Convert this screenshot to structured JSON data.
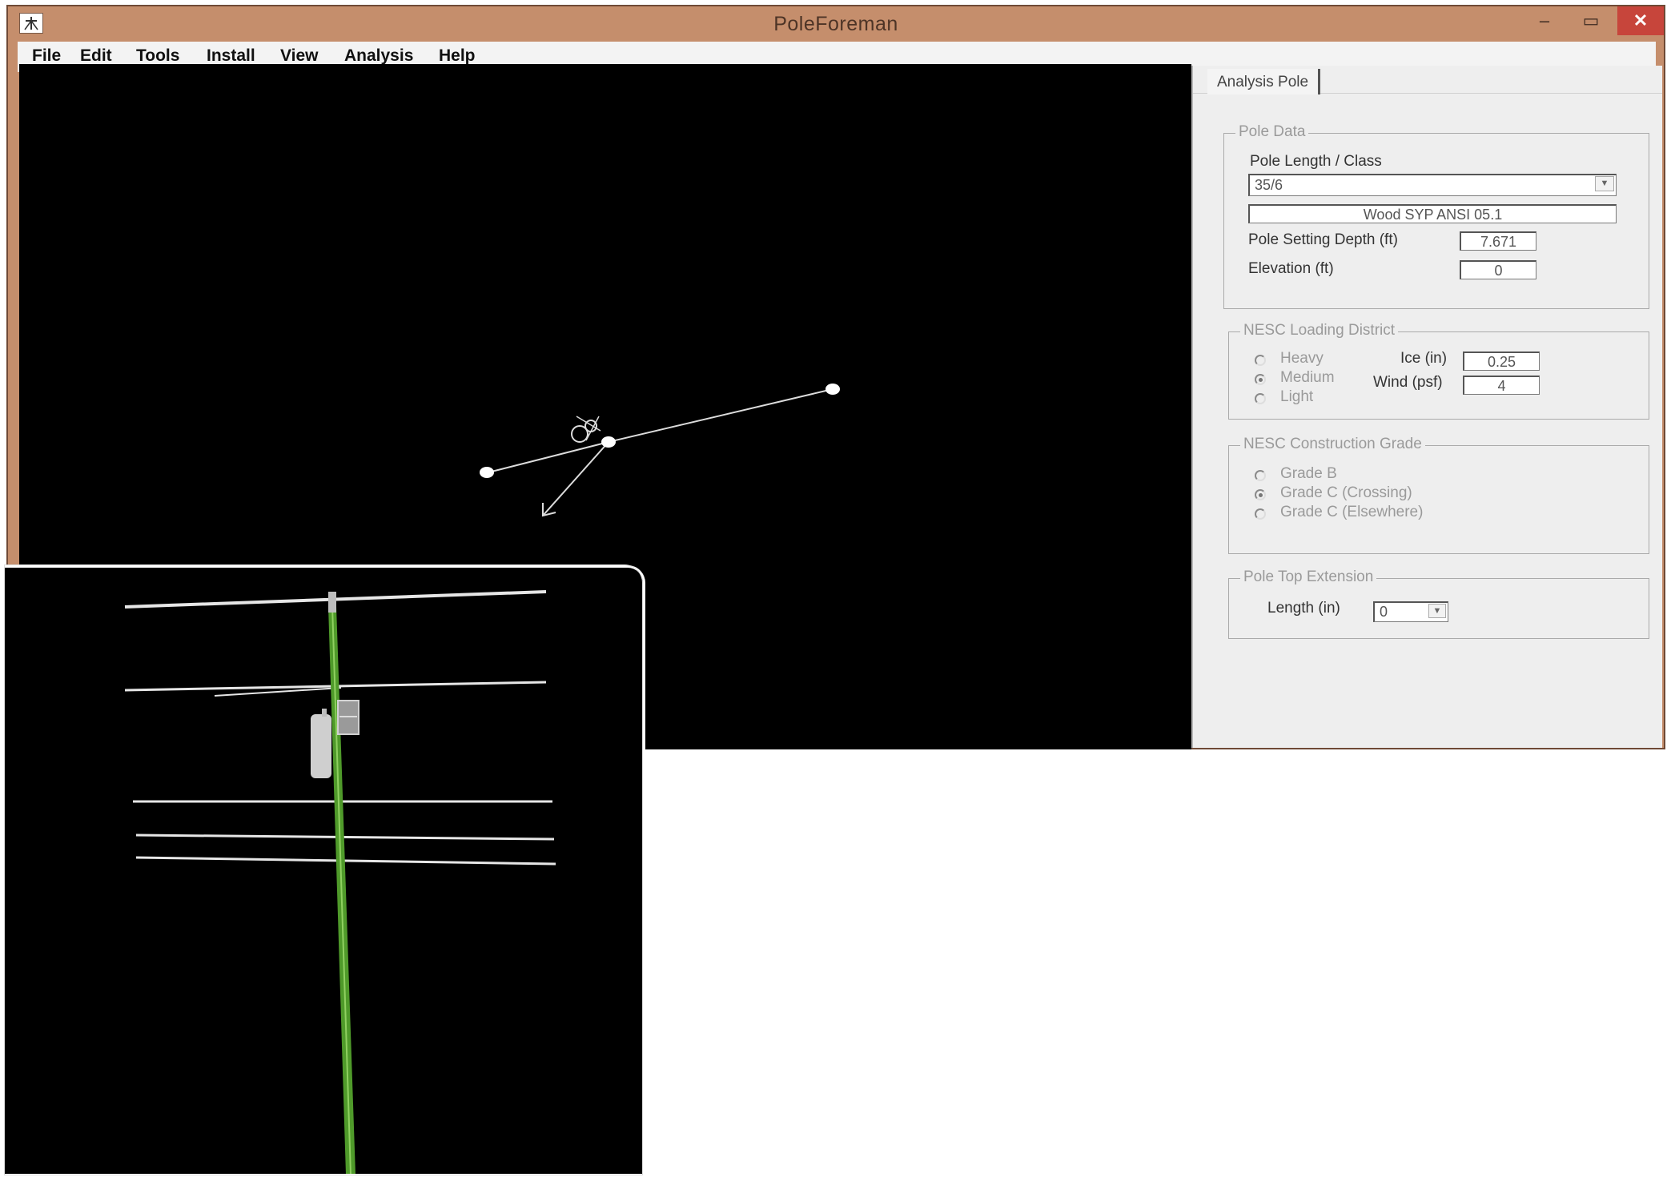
{
  "window": {
    "title": "PoleForeman",
    "minimize_glyph": "‒",
    "maximize_glyph": "▭",
    "close_glyph": "✕"
  },
  "menu": {
    "file": "File",
    "edit": "Edit",
    "tools": "Tools",
    "install": "Install",
    "view": "View",
    "analysis": "Analysis",
    "help": "Help"
  },
  "panel": {
    "tab": "Analysis Pole",
    "pole_data": {
      "title": "Pole Data",
      "length_class_label": "Pole Length / Class",
      "length_class_value": "35/6",
      "material": "Wood SYP ANSI 05.1",
      "setting_depth_label": "Pole Setting Depth (ft)",
      "setting_depth_value": "7.671",
      "elevation_label": "Elevation (ft)",
      "elevation_value": "0"
    },
    "loading_district": {
      "title": "NESC Loading District",
      "options": [
        "Heavy",
        "Medium",
        "Light"
      ],
      "selected": "Medium",
      "ice_label": "Ice (in)",
      "ice_value": "0.25",
      "wind_label": "Wind (psf)",
      "wind_value": "4"
    },
    "construction_grade": {
      "title": "NESC Construction Grade",
      "options": [
        "Grade B",
        "Grade C (Crossing)",
        "Grade C (Elsewhere)"
      ],
      "selected": "Grade C (Crossing)"
    },
    "pole_top_extension": {
      "title": "Pole Top Extension",
      "length_label": "Length (in)",
      "length_value": "0"
    }
  },
  "colors": {
    "titlebar": "#c58e6c",
    "close_button": "#c7453b",
    "viewport": "#000000",
    "pole": "#4f9a2a",
    "wire": "#e6e6e6"
  },
  "icons": {
    "app": "app-logo-icon",
    "dropdown": "chevron-down-icon"
  }
}
